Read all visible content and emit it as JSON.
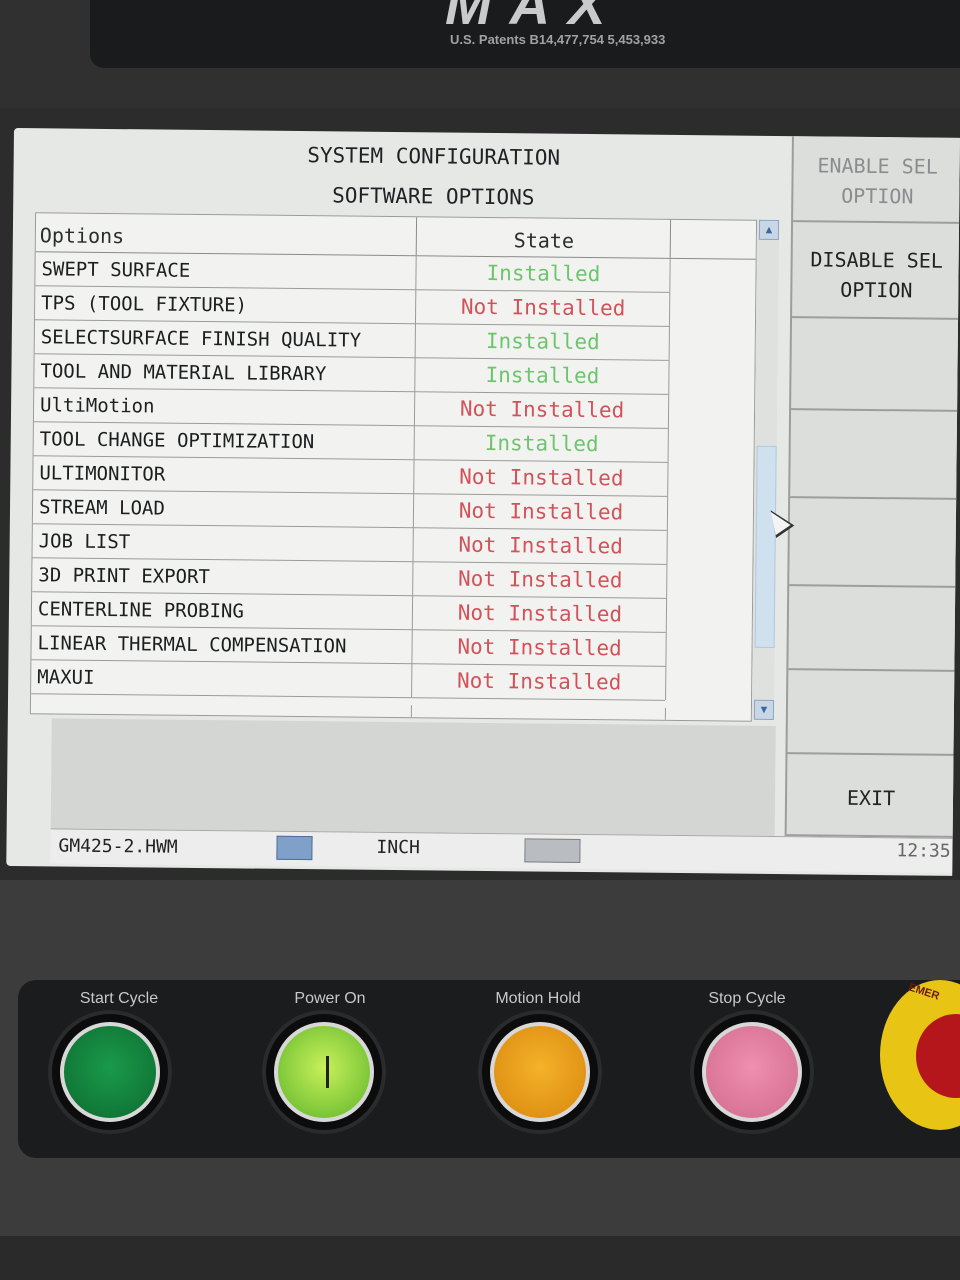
{
  "machine": {
    "logo": "MAX",
    "patents": "U.S. Patents  B14,477,754  5,453,933"
  },
  "header": {
    "title": "SYSTEM CONFIGURATION",
    "subtitle": "SOFTWARE OPTIONS"
  },
  "grid": {
    "columns": [
      "Options",
      "State"
    ],
    "rows": [
      {
        "option": "SWEPT SURFACE",
        "state": "Installed"
      },
      {
        "option": "TPS (TOOL FIXTURE)",
        "state": "Not Installed"
      },
      {
        "option": "SELECTSURFACE FINISH QUALITY",
        "state": "Installed"
      },
      {
        "option": "TOOL AND MATERIAL LIBRARY",
        "state": "Installed"
      },
      {
        "option": "UltiMotion",
        "state": "Not Installed"
      },
      {
        "option": "TOOL CHANGE OPTIMIZATION",
        "state": "Installed"
      },
      {
        "option": "ULTIMONITOR",
        "state": "Not Installed"
      },
      {
        "option": "STREAM LOAD",
        "state": "Not Installed"
      },
      {
        "option": "JOB LIST",
        "state": "Not Installed"
      },
      {
        "option": "3D PRINT EXPORT",
        "state": "Not Installed"
      },
      {
        "option": "CENTERLINE PROBING",
        "state": "Not Installed"
      },
      {
        "option": "LINEAR THERMAL COMPENSATION",
        "state": "Not Installed"
      },
      {
        "option": "MAXUI",
        "state": "Not Installed"
      }
    ]
  },
  "side_buttons": {
    "enable": "ENABLE SEL OPTION",
    "disable": "DISABLE SEL OPTION",
    "exit": "EXIT"
  },
  "status_bar": {
    "file": "GM425-2.HWM",
    "units": "INCH",
    "time": "12:35"
  },
  "panel_buttons": {
    "start_cycle": "Start Cycle",
    "power_on": "Power On",
    "motion_hold": "Motion Hold",
    "stop_cycle": "Stop Cycle",
    "emergency": "EMER"
  },
  "colors": {
    "installed": "#6cc56c",
    "not_installed": "#d2525a"
  }
}
